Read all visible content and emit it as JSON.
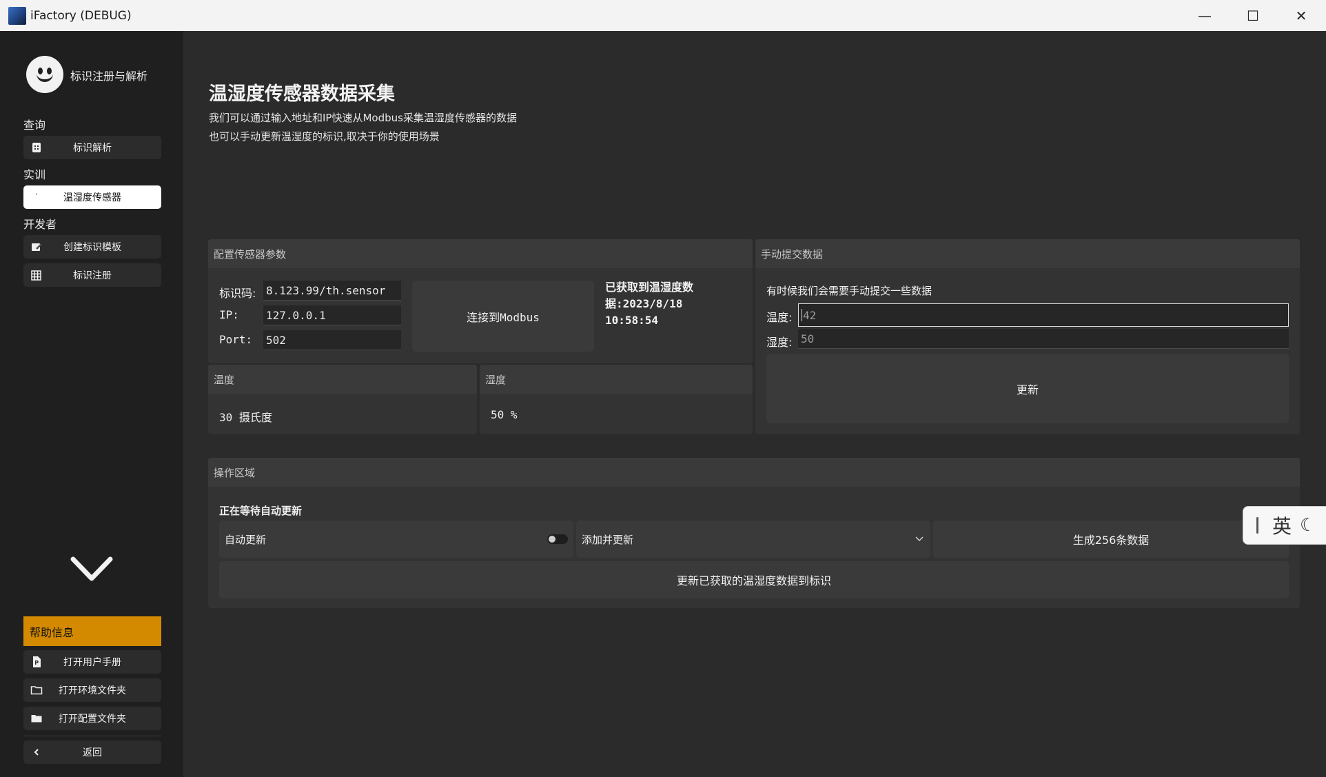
{
  "window": {
    "title": "iFactory (DEBUG)",
    "minimize": "—",
    "maximize": "☐",
    "close": "✕"
  },
  "sidebar": {
    "brand": "标识注册与解析",
    "sections": [
      {
        "label": "查询",
        "items": [
          {
            "label": "标识解析",
            "icon": "building-icon"
          }
        ]
      },
      {
        "label": "实训",
        "items": [
          {
            "label": "温湿度传感器",
            "icon": "sensor-icon"
          }
        ]
      },
      {
        "label": "开发者",
        "items": [
          {
            "label": "创建标识模板",
            "icon": "edit-icon"
          },
          {
            "label": "标识注册",
            "icon": "grid-icon"
          }
        ]
      }
    ],
    "help": {
      "title": "帮助信息",
      "items": [
        {
          "label": "打开用户手册",
          "icon": "document-icon"
        },
        {
          "label": "打开环境文件夹",
          "icon": "folder-outline-icon"
        },
        {
          "label": "打开配置文件夹",
          "icon": "folder-icon"
        }
      ]
    },
    "back": "返回"
  },
  "page": {
    "title": "温湿度传感器数据采集",
    "desc1": "我们可以通过输入地址和IP快速从Modbus采集温湿度传感器的数据",
    "desc2": "也可以手动更新温湿度的标识,取决于你的使用场景"
  },
  "config": {
    "header": "配置传感器参数",
    "code_label": "标识码:",
    "code_value": "8.123.99/th.sensor",
    "ip_label": "IP:",
    "ip_value": "127.0.0.1",
    "port_label": "Port:",
    "port_value": "502",
    "connect_button": "连接到Modbus",
    "status_line1": "已获取到温湿度数",
    "status_line2": "据:2023/8/18",
    "status_line3": "10:58:54"
  },
  "temperature": {
    "header": "温度",
    "value": "30 摄氏度"
  },
  "humidity": {
    "header": "湿度",
    "value": "50 %"
  },
  "manual": {
    "header": "手动提交数据",
    "hint": "有时候我们会需要手动提交一些数据",
    "temp_label": "温度:",
    "temp_value": "42",
    "hum_label": "湿度:",
    "hum_value": "50",
    "update_button": "更新"
  },
  "operations": {
    "header": "操作区域",
    "status": "正在等待自动更新",
    "auto_update_label": "自动更新",
    "auto_update_on": false,
    "mode_selected": "添加并更新",
    "generate_button": "生成256条数据",
    "push_button": "更新已获取的温湿度数据到标识"
  },
  "ime": {
    "mode": "英"
  },
  "colors": {
    "help_accent": "#d48a00",
    "sidebar_bg": "#1f1f1f",
    "main_bg": "#2b2b2b",
    "panel_bg": "#333333"
  }
}
